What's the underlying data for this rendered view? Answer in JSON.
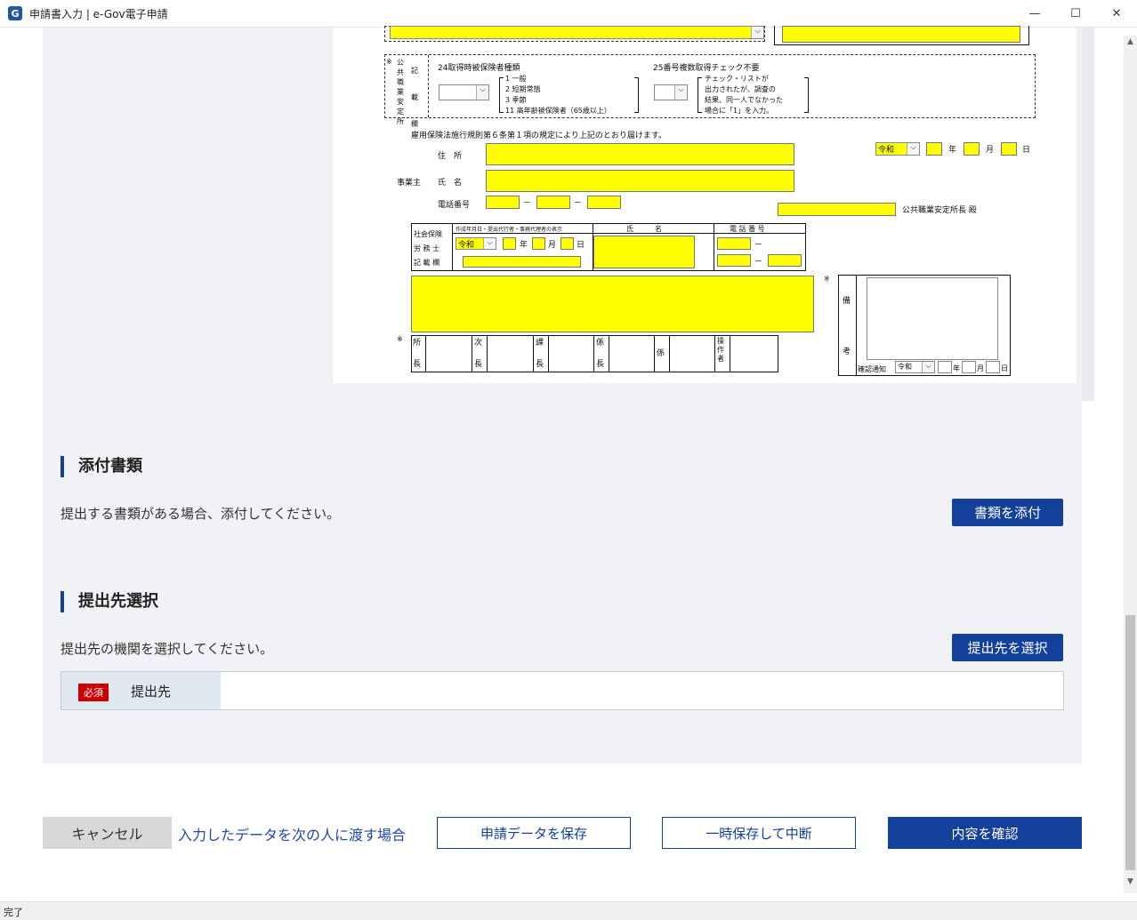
{
  "window": {
    "title": "申請書入力 | e-Gov電子申請",
    "app_icon": "G",
    "minimize": "—",
    "maximize": "☐",
    "close": "✕"
  },
  "form": {
    "mark_kome": "※",
    "official_col_chars": [
      "公",
      "共",
      "職",
      "業",
      "安",
      "定",
      "所"
    ],
    "official_col_chars2": [
      "記",
      "載",
      "欄"
    ],
    "item24_label": "24取得時被保険者種類",
    "item24_options": [
      "1 一般",
      "2 短期常態",
      "3 季節",
      "11 高年齢被保険者（65歳以上）"
    ],
    "item25_label": "25番号複数取得チェック不要",
    "item25_notes": [
      "チェック・リストが",
      "出力されたが、調査の",
      "結果、同一人でなかった",
      "場合に「1」を入力。"
    ],
    "declaration": "雇用保険法施行規則第６条第１項の規定により上記のとおり届けます。",
    "era_value": "令和",
    "year_label": "年",
    "month_label": "月",
    "day_label": "日",
    "address_label": "住　所",
    "employer_label": "事業主",
    "name_label": "氏　名",
    "phone_label": "電話番号",
    "dash": "－",
    "office_suffix": "公共職業安定所長 殿",
    "sharoushi_labels": [
      "社会保険",
      "労 務 士",
      "記 載 欄"
    ],
    "sharoushi_header1": "作成年月日・提出代行者・事務代理者の表示",
    "sharoushi_header2": "氏　　　名",
    "sharoushi_header3": "電 話 番 号",
    "stamp_cells": [
      {
        "top": "所",
        "bottom": "長"
      },
      {
        "top": "次",
        "bottom": "長"
      },
      {
        "top": "課",
        "bottom": "長"
      },
      {
        "top": "係",
        "bottom": "長"
      },
      {
        "top": "",
        "bottom": "係"
      },
      {
        "top": "操",
        "bottom": "作者"
      }
    ],
    "remarks_label_top": "備",
    "remarks_label_bottom": "考",
    "confirm_notice_label": "確認通知"
  },
  "attachments": {
    "title": "添付書類",
    "description": "提出する書類がある場合、添付してください。",
    "button": "書類を添付"
  },
  "destination": {
    "title": "提出先選択",
    "description": "提出先の機関を選択してください。",
    "button": "提出先を選択",
    "required_badge": "必須",
    "field_label": "提出先",
    "field_value": ""
  },
  "footer": {
    "cancel": "キャンセル",
    "pass_link": "入力したデータを次の人に渡す場合",
    "save": "申請データを保存",
    "suspend": "一時保存して中断",
    "confirm": "内容を確認"
  },
  "status": {
    "text": "完了"
  },
  "colors": {
    "accent": "#13409b",
    "input_yellow": "#ffff00",
    "panel_bg": "#f0f2f5",
    "required_red": "#cc0000"
  }
}
